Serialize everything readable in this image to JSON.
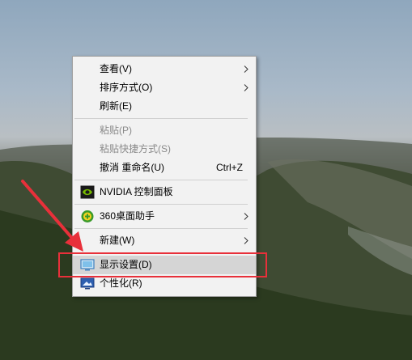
{
  "context_menu": {
    "items": [
      {
        "label": "查看(V)"
      },
      {
        "label": "排序方式(O)"
      },
      {
        "label": "刷新(E)"
      },
      {
        "label": "粘贴(P)"
      },
      {
        "label": "粘贴快捷方式(S)"
      },
      {
        "label": "撤消 重命名(U)",
        "shortcut": "Ctrl+Z"
      },
      {
        "label": "NVIDIA 控制面板"
      },
      {
        "label": "360桌面助手"
      },
      {
        "label": "新建(W)"
      },
      {
        "label": "显示设置(D)"
      },
      {
        "label": "个性化(R)"
      }
    ]
  },
  "colors": {
    "highlight": "#d5d5d5",
    "annotation": "#e8303a",
    "nvidia_green": "#76b900",
    "menu_background": "#f2f2f2"
  },
  "icons": {
    "nvidia": "nvidia-icon",
    "assistant_360": "360-icon",
    "display": "display-settings-icon",
    "personalize": "personalize-icon",
    "submenu": "chevron-right-icon"
  }
}
